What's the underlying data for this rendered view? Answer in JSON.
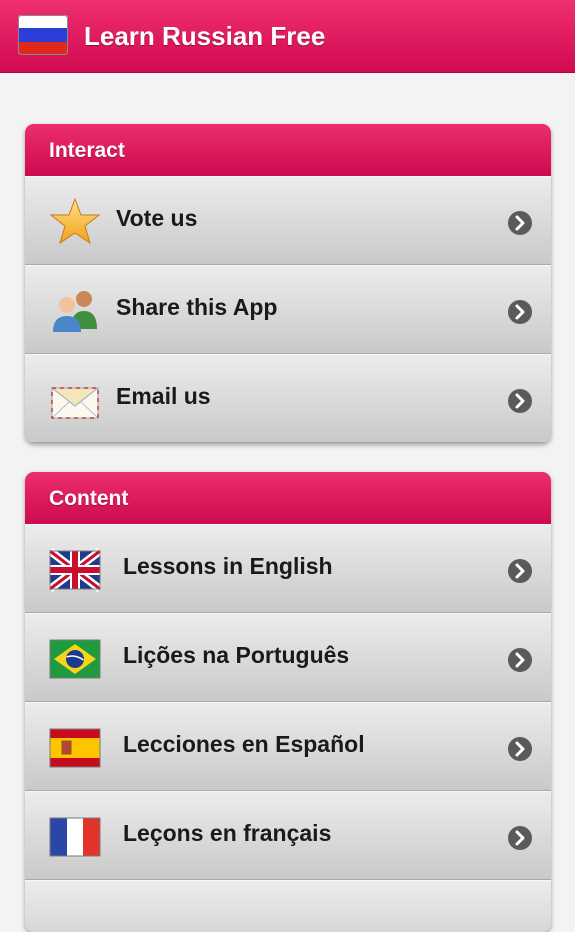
{
  "app": {
    "title": "Learn Russian Free",
    "flag_icon": "russia-flag-icon"
  },
  "sections": {
    "interact": {
      "title": "Interact",
      "items": [
        {
          "label": "Vote us",
          "icon": "star-icon"
        },
        {
          "label": "Share this App",
          "icon": "users-icon"
        },
        {
          "label": "Email us",
          "icon": "envelope-icon"
        }
      ]
    },
    "content": {
      "title": "Content",
      "items": [
        {
          "label": "Lessons in English",
          "icon": "uk-flag-icon"
        },
        {
          "label": "Lições na Português",
          "icon": "brazil-flag-icon"
        },
        {
          "label": "Lecciones en Español",
          "icon": "spain-flag-icon"
        },
        {
          "label": "Leçons en français",
          "icon": "france-flag-icon"
        }
      ]
    }
  },
  "colors": {
    "accent": "#d80d56",
    "row_text": "#1a1a1a",
    "background": "#f3f3f3"
  }
}
